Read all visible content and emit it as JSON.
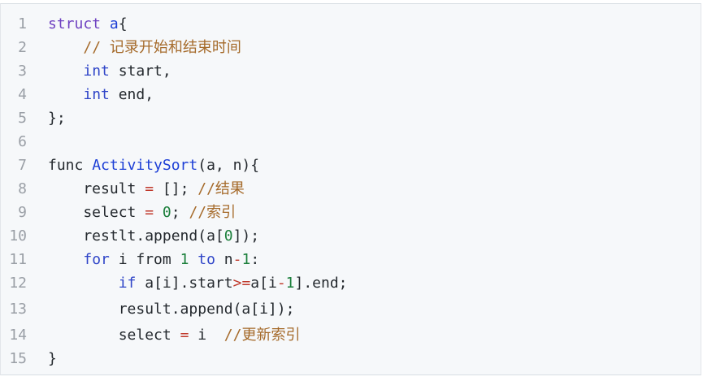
{
  "code_block": {
    "language_hint": "",
    "lines": [
      {
        "num": "1",
        "tokens": [
          {
            "t": "struct",
            "c": "kw"
          },
          {
            "t": " ",
            "c": "tx"
          },
          {
            "t": "a",
            "c": "fn"
          },
          {
            "t": "{",
            "c": "tx"
          }
        ]
      },
      {
        "num": "2",
        "tokens": [
          {
            "t": "    ",
            "c": "tx"
          },
          {
            "t": "// 记录开始和结束时间",
            "c": "cm"
          }
        ]
      },
      {
        "num": "3",
        "tokens": [
          {
            "t": "    ",
            "c": "tx"
          },
          {
            "t": "int",
            "c": "kw2"
          },
          {
            "t": " start,",
            "c": "tx"
          }
        ]
      },
      {
        "num": "4",
        "tokens": [
          {
            "t": "    ",
            "c": "tx"
          },
          {
            "t": "int",
            "c": "kw2"
          },
          {
            "t": " end,",
            "c": "tx"
          }
        ]
      },
      {
        "num": "5",
        "tokens": [
          {
            "t": "};",
            "c": "tx"
          }
        ]
      },
      {
        "num": "6",
        "tokens": [
          {
            "t": "",
            "c": "tx"
          }
        ]
      },
      {
        "num": "7",
        "tokens": [
          {
            "t": "func ",
            "c": "tx"
          },
          {
            "t": "ActivitySort",
            "c": "fn"
          },
          {
            "t": "(a, n){",
            "c": "tx"
          }
        ]
      },
      {
        "num": "8",
        "tokens": [
          {
            "t": "    result ",
            "c": "tx"
          },
          {
            "t": "=",
            "c": "op"
          },
          {
            "t": " []; ",
            "c": "tx"
          },
          {
            "t": "//结果",
            "c": "cm"
          }
        ]
      },
      {
        "num": "9",
        "tokens": [
          {
            "t": "    select ",
            "c": "tx"
          },
          {
            "t": "=",
            "c": "op"
          },
          {
            "t": " ",
            "c": "tx"
          },
          {
            "t": "0",
            "c": "num"
          },
          {
            "t": "; ",
            "c": "tx"
          },
          {
            "t": "//索引",
            "c": "cm"
          }
        ]
      },
      {
        "num": "10",
        "tokens": [
          {
            "t": "    restlt.append(a[",
            "c": "tx"
          },
          {
            "t": "0",
            "c": "num"
          },
          {
            "t": "]);",
            "c": "tx"
          }
        ]
      },
      {
        "num": "11",
        "tokens": [
          {
            "t": "    ",
            "c": "tx"
          },
          {
            "t": "for",
            "c": "kw2"
          },
          {
            "t": " i from ",
            "c": "tx"
          },
          {
            "t": "1",
            "c": "num"
          },
          {
            "t": " ",
            "c": "tx"
          },
          {
            "t": "to",
            "c": "kw2"
          },
          {
            "t": " n",
            "c": "tx"
          },
          {
            "t": "-",
            "c": "op"
          },
          {
            "t": "1",
            "c": "num"
          },
          {
            "t": ":",
            "c": "tx"
          }
        ]
      },
      {
        "num": "12",
        "tokens": [
          {
            "t": "        ",
            "c": "tx"
          },
          {
            "t": "if",
            "c": "kw2"
          },
          {
            "t": " a[i].start",
            "c": "tx"
          },
          {
            "t": ">=",
            "c": "op"
          },
          {
            "t": "a[i",
            "c": "tx"
          },
          {
            "t": "-",
            "c": "op"
          },
          {
            "t": "1",
            "c": "num"
          },
          {
            "t": "].end;",
            "c": "tx"
          }
        ]
      },
      {
        "num": "13",
        "tokens": [
          {
            "t": "        result.append(a[i]);",
            "c": "tx"
          }
        ]
      },
      {
        "num": "14",
        "tokens": [
          {
            "t": "        select ",
            "c": "tx"
          },
          {
            "t": "=",
            "c": "op"
          },
          {
            "t": " i  ",
            "c": "tx"
          },
          {
            "t": "//更新索引",
            "c": "cm"
          }
        ]
      },
      {
        "num": "15",
        "tokens": [
          {
            "t": "}",
            "c": "tx"
          }
        ]
      }
    ]
  }
}
